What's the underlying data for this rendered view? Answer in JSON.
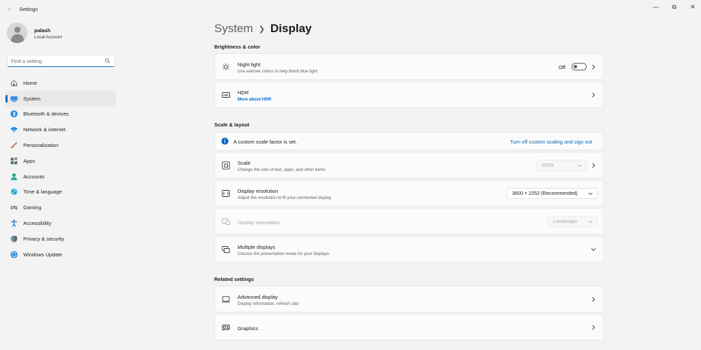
{
  "window": {
    "title": "Settings"
  },
  "user": {
    "name": "palash",
    "account_type": "Local Account"
  },
  "search": {
    "placeholder": "Find a setting"
  },
  "nav": [
    {
      "label": "Home",
      "icon": "home-icon"
    },
    {
      "label": "System",
      "icon": "system-icon",
      "active": true
    },
    {
      "label": "Bluetooth & devices",
      "icon": "bluetooth-icon"
    },
    {
      "label": "Network & internet",
      "icon": "wifi-icon"
    },
    {
      "label": "Personalization",
      "icon": "brush-icon"
    },
    {
      "label": "Apps",
      "icon": "apps-icon"
    },
    {
      "label": "Accounts",
      "icon": "accounts-icon"
    },
    {
      "label": "Time & language",
      "icon": "globe-icon"
    },
    {
      "label": "Gaming",
      "icon": "gamepad-icon"
    },
    {
      "label": "Accessibility",
      "icon": "accessibility-icon"
    },
    {
      "label": "Privacy & security",
      "icon": "shield-icon"
    },
    {
      "label": "Windows Update",
      "icon": "update-icon"
    }
  ],
  "breadcrumb": {
    "parent": "System",
    "current": "Display"
  },
  "brightness": {
    "title": "Brightness & color",
    "night_light": {
      "title": "Night light",
      "subtitle": "Use warmer colors to help block blue light",
      "state": "Off"
    },
    "hdr": {
      "title": "HDR",
      "link": "More about HDR"
    }
  },
  "scale_layout": {
    "title": "Scale & layout",
    "notice": {
      "text": "A custom scale factor is set.",
      "action": "Turn off custom scaling and sign out"
    },
    "scale": {
      "title": "Scale",
      "subtitle": "Change the size of text, apps, and other items",
      "value": "350%"
    },
    "resolution": {
      "title": "Display resolution",
      "subtitle": "Adjust the resolution to fit your connected display",
      "value": "3600 × 2252 (Recommended)"
    },
    "orientation": {
      "title": "Display orientation",
      "value": "Landscape"
    },
    "multiple": {
      "title": "Multiple displays",
      "subtitle": "Choose the presentation mode for your displays"
    }
  },
  "related": {
    "title": "Related settings",
    "advanced": {
      "title": "Advanced display",
      "subtitle": "Display information, refresh rate"
    },
    "graphics": {
      "title": "Graphics"
    }
  },
  "colors": {
    "accent": "#0067c0"
  }
}
